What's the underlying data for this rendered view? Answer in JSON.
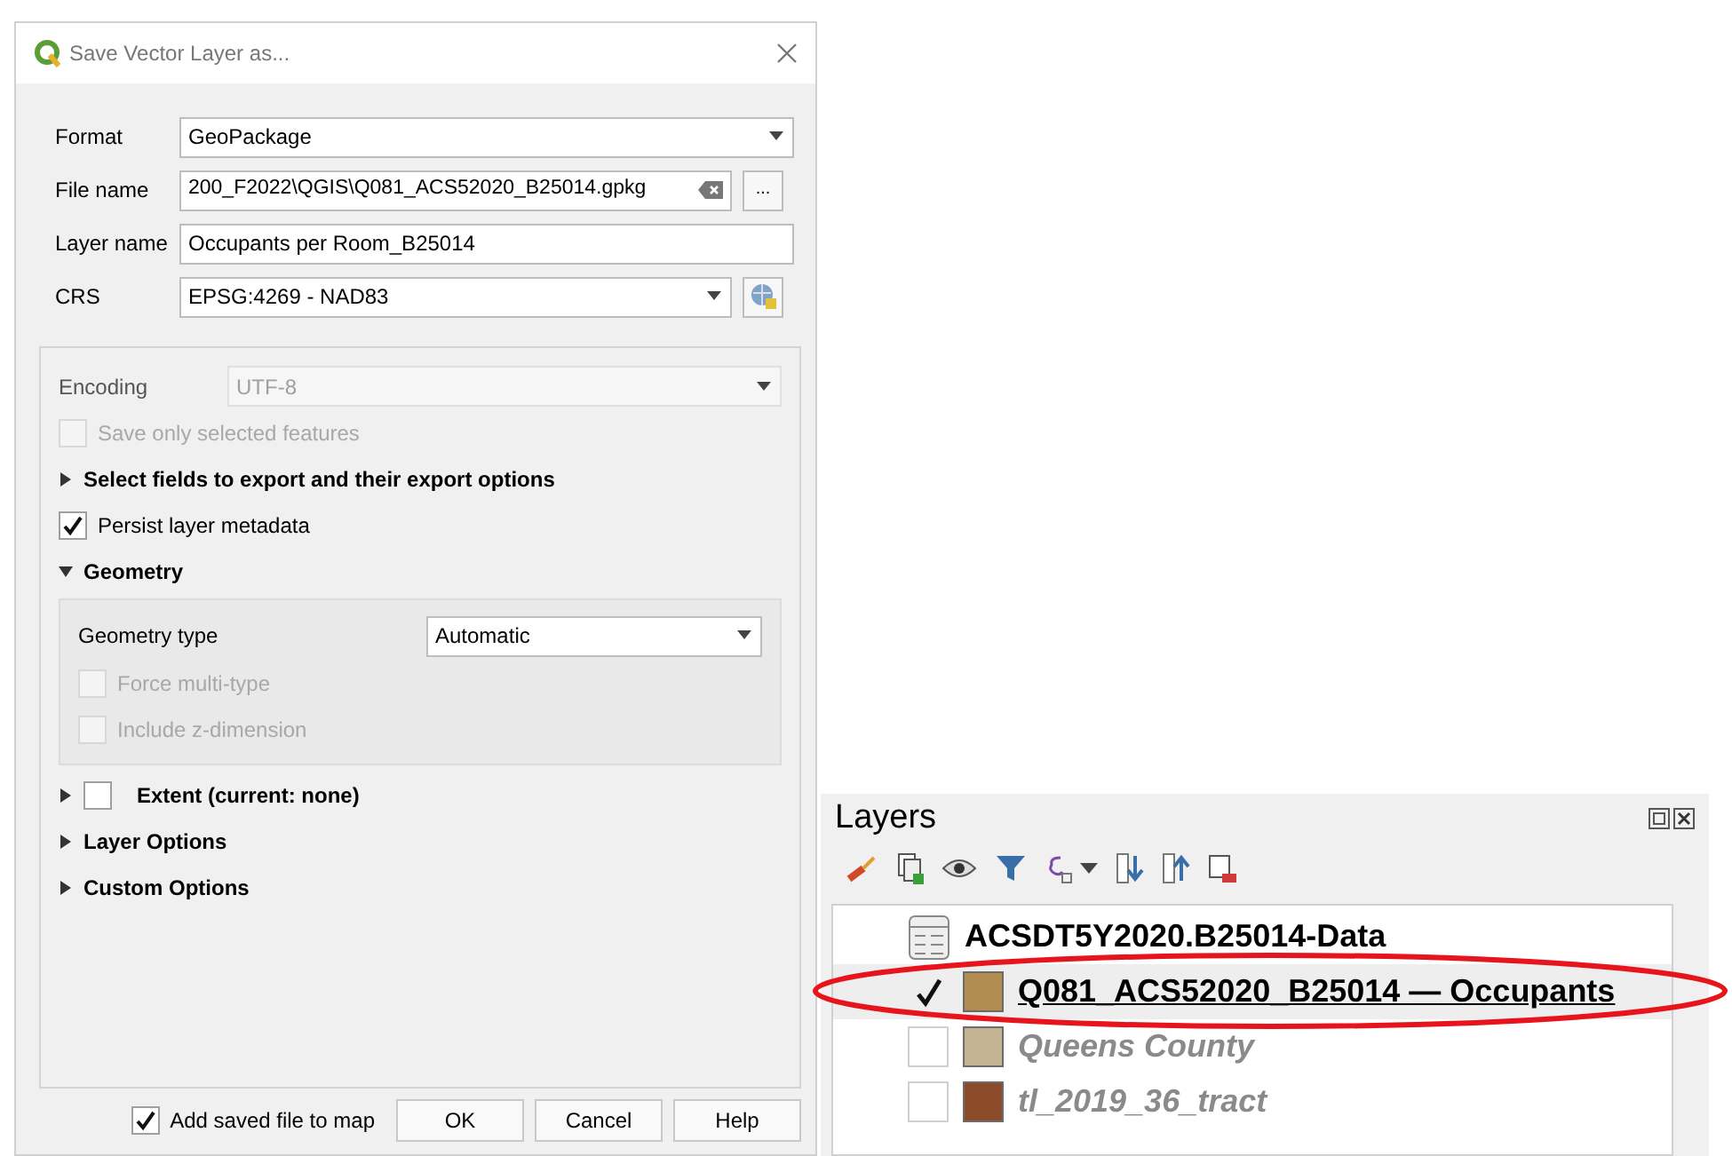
{
  "dialog": {
    "title": "Save Vector Layer as...",
    "fields": [
      {
        "kind": "dropdown",
        "label": "Format",
        "value": "GeoPackage"
      },
      {
        "kind": "file",
        "label": "File name",
        "value": "200_F2022\\QGIS\\Q081_ACS52020_B25014.gpkg",
        "browse": "..."
      },
      {
        "kind": "text",
        "label": "Layer name",
        "value": "Occupants per Room_B25014"
      },
      {
        "kind": "crs",
        "label": "CRS",
        "value": "EPSG:4269 - NAD83"
      }
    ],
    "options": [
      {
        "kind": "dropdown",
        "label": "Encoding",
        "value": "UTF-8",
        "disabled": true
      },
      {
        "kind": "checkbox",
        "label": "Save only selected features",
        "checked": false,
        "disabled": true
      },
      {
        "kind": "section",
        "label": "Select fields to export and their export options",
        "expanded": false
      },
      {
        "kind": "checkbox",
        "label": "Persist layer metadata",
        "checked": true,
        "disabled": false
      },
      {
        "kind": "section",
        "label": "Geometry",
        "expanded": true,
        "children": [
          {
            "kind": "dropdown",
            "label": "Geometry type",
            "value": "Automatic",
            "disabled": false
          },
          {
            "kind": "checkbox",
            "label": "Force multi-type",
            "checked": false,
            "disabled": true
          },
          {
            "kind": "checkbox",
            "label": "Include z-dimension",
            "checked": false,
            "disabled": true
          }
        ]
      },
      {
        "kind": "checksection",
        "label": "Extent (current: none)",
        "expanded": false,
        "checked": false
      },
      {
        "kind": "section",
        "label": "Layer Options",
        "expanded": false
      },
      {
        "kind": "section",
        "label": "Custom Options",
        "expanded": false
      }
    ],
    "add_to_map": {
      "label": "Add saved file to map",
      "checked": true
    },
    "buttons": [
      "OK",
      "Cancel",
      "Help"
    ]
  },
  "layers_panel": {
    "title": "Layers",
    "layers": [
      {
        "kind": "table",
        "name": "ACSDT5Y2020.B25014-Data",
        "selected": false
      },
      {
        "kind": "vector",
        "name": "Q081_ACS52020_B25014 — Occupants",
        "checked": true,
        "selected": true,
        "color": "#b08c50"
      },
      {
        "kind": "vector",
        "name": "Queens County",
        "checked": false,
        "selected": false,
        "color": "#c4b494"
      },
      {
        "kind": "vector",
        "name": "tl_2019_36_tract",
        "checked": false,
        "selected": false,
        "color": "#8c4c2c"
      }
    ]
  }
}
